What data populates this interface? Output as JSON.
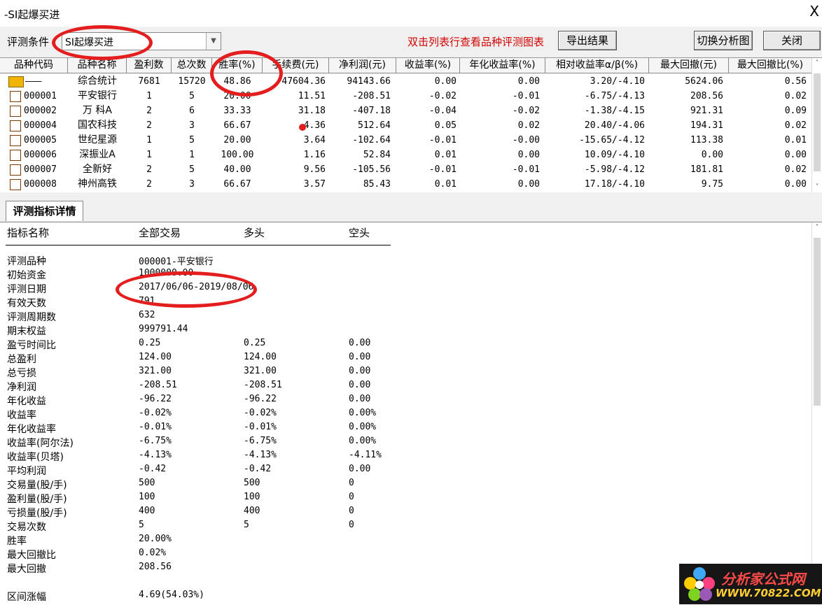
{
  "window": {
    "title": "-SI起爆买进",
    "close_glyph": "X"
  },
  "toolbar": {
    "condition_label": "评测条件",
    "condition_value": "SI起爆买进",
    "hint": "双击列表行查看品种评测图表",
    "export_label": "导出结果",
    "switch_label": "切换分析图",
    "close_label": "关闭"
  },
  "grid": {
    "headers": [
      "品种代码",
      "品种名称",
      "盈利数",
      "总次数",
      "胜率(%)",
      "手续费(元)",
      "净利润(元)",
      "收益率(%)",
      "年化收益率(%)",
      "相对收益率α/β(%)",
      "最大回撤(元)",
      "最大回撤比(%)"
    ],
    "rows": [
      {
        "code": "———",
        "name": "综合统计",
        "wins": "7681",
        "total": "15720",
        "rate": "48.86",
        "fee": "47604.36",
        "net": "94143.66",
        "ret": "0.00",
        "annual": "0.00",
        "relative": "3.20/-4.10",
        "maxdd": "5624.06",
        "ddratio": "0.56"
      },
      {
        "code": "000001",
        "name": "平安银行",
        "wins": "1",
        "total": "5",
        "rate": "20.00",
        "fee": "11.51",
        "net": "-208.51",
        "ret": "-0.02",
        "annual": "-0.01",
        "relative": "-6.75/-4.13",
        "maxdd": "208.56",
        "ddratio": "0.02"
      },
      {
        "code": "000002",
        "name": "万 科A",
        "wins": "2",
        "total": "6",
        "rate": "33.33",
        "fee": "31.18",
        "net": "-407.18",
        "ret": "-0.04",
        "annual": "-0.02",
        "relative": "-1.38/-4.15",
        "maxdd": "921.31",
        "ddratio": "0.09"
      },
      {
        "code": "000004",
        "name": "国农科技",
        "wins": "2",
        "total": "3",
        "rate": "66.67",
        "fee": "4.36",
        "net": "512.64",
        "ret": "0.05",
        "annual": "0.02",
        "relative": "20.40/-4.06",
        "maxdd": "194.31",
        "ddratio": "0.02"
      },
      {
        "code": "000005",
        "name": "世纪星源",
        "wins": "1",
        "total": "5",
        "rate": "20.00",
        "fee": "3.64",
        "net": "-102.64",
        "ret": "-0.01",
        "annual": "-0.00",
        "relative": "-15.65/-4.12",
        "maxdd": "113.38",
        "ddratio": "0.01"
      },
      {
        "code": "000006",
        "name": "深振业A",
        "wins": "1",
        "total": "1",
        "rate": "100.00",
        "fee": "1.16",
        "net": "52.84",
        "ret": "0.01",
        "annual": "0.00",
        "relative": "10.09/-4.10",
        "maxdd": "0.00",
        "ddratio": "0.00"
      },
      {
        "code": "000007",
        "name": "全新好",
        "wins": "2",
        "total": "5",
        "rate": "40.00",
        "fee": "9.56",
        "net": "-105.56",
        "ret": "-0.01",
        "annual": "-0.01",
        "relative": "-5.98/-4.12",
        "maxdd": "181.81",
        "ddratio": "0.02"
      },
      {
        "code": "000008",
        "name": "神州高铁",
        "wins": "2",
        "total": "3",
        "rate": "66.67",
        "fee": "3.57",
        "net": "85.43",
        "ret": "0.01",
        "annual": "0.00",
        "relative": "17.18/-4.10",
        "maxdd": "9.75",
        "ddratio": "0.00"
      }
    ]
  },
  "detail": {
    "tab_label": "评测指标详情",
    "col_headers": [
      "指标名称",
      "全部交易",
      "多头",
      "空头"
    ],
    "rows": [
      {
        "label": "评测品种",
        "all": "000001-平安银行",
        "long": "",
        "short": ""
      },
      {
        "label": "初始资金",
        "all": "1000000.00",
        "long": "",
        "short": ""
      },
      {
        "label": "评测日期",
        "all": "2017/06/06-2019/08/06",
        "long": "",
        "short": ""
      },
      {
        "label": "有效天数",
        "all": "791",
        "long": "",
        "short": ""
      },
      {
        "label": "评测周期数",
        "all": "632",
        "long": "",
        "short": ""
      },
      {
        "label": "期末权益",
        "all": "999791.44",
        "long": "",
        "short": ""
      },
      {
        "label": "盈亏时间比",
        "all": "0.25",
        "long": "0.25",
        "short": "0.00"
      },
      {
        "label": "总盈利",
        "all": "124.00",
        "long": "124.00",
        "short": "0.00"
      },
      {
        "label": "总亏损",
        "all": "321.00",
        "long": "321.00",
        "short": "0.00"
      },
      {
        "label": "净利润",
        "all": "-208.51",
        "long": "-208.51",
        "short": "0.00"
      },
      {
        "label": "年化收益",
        "all": "-96.22",
        "long": "-96.22",
        "short": "0.00"
      },
      {
        "label": "收益率",
        "all": "-0.02%",
        "long": "-0.02%",
        "short": "0.00%"
      },
      {
        "label": "年化收益率",
        "all": "-0.01%",
        "long": "-0.01%",
        "short": "0.00%"
      },
      {
        "label": "收益率(阿尔法)",
        "all": "-6.75%",
        "long": "-6.75%",
        "short": "0.00%"
      },
      {
        "label": "收益率(贝塔)",
        "all": "-4.13%",
        "long": "-4.13%",
        "short": "-4.11%"
      },
      {
        "label": "平均利润",
        "all": "-0.42",
        "long": "-0.42",
        "short": "0.00"
      },
      {
        "label": "交易量(股/手)",
        "all": "500",
        "long": "500",
        "short": "0"
      },
      {
        "label": "盈利量(股/手)",
        "all": "100",
        "long": "100",
        "short": "0"
      },
      {
        "label": "亏损量(股/手)",
        "all": "400",
        "long": "400",
        "short": "0"
      },
      {
        "label": "交易次数",
        "all": "5",
        "long": "5",
        "short": "0"
      },
      {
        "label": "胜率",
        "all": "20.00%",
        "long": "",
        "short": ""
      },
      {
        "label": "最大回撤比",
        "all": "0.02%",
        "long": "",
        "short": ""
      },
      {
        "label": "最大回撤",
        "all": "208.56",
        "long": "",
        "short": ""
      },
      {
        "label": "区间涨幅",
        "all": "4.69(54.03%)",
        "long": "",
        "short": ""
      }
    ]
  },
  "watermark": {
    "brand": "分析家公式网",
    "url": "WWW.70822.COM"
  },
  "colors": {
    "annotation": "#e41e1e",
    "hint_text": "#d40000",
    "folder_icon": "#f0b400"
  },
  "icons": {
    "row_icon": "document-icon",
    "summary_icon": "folder-icon",
    "dropdown": "chevron-down-icon"
  }
}
